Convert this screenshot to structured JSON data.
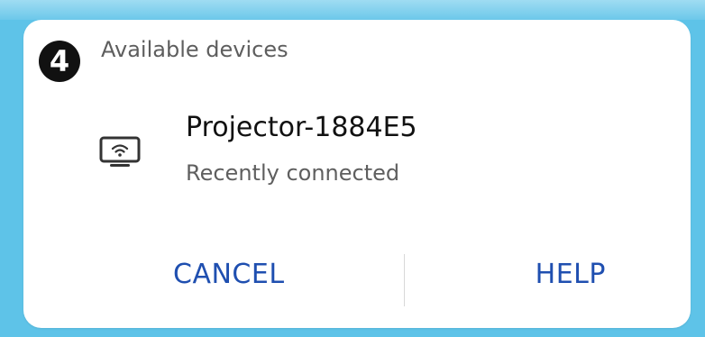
{
  "step_badge": "4",
  "dialog": {
    "title": "Available devices",
    "device": {
      "icon": "screen-cast-icon",
      "name": "Projector-1884E5",
      "status": "Recently connected"
    },
    "actions": {
      "cancel_label": "CANCEL",
      "help_label": "HELP"
    }
  },
  "colors": {
    "background": "#5ec3e8",
    "dialog": "#ffffff",
    "accent": "#1f4fb0",
    "badge": "#111111"
  }
}
